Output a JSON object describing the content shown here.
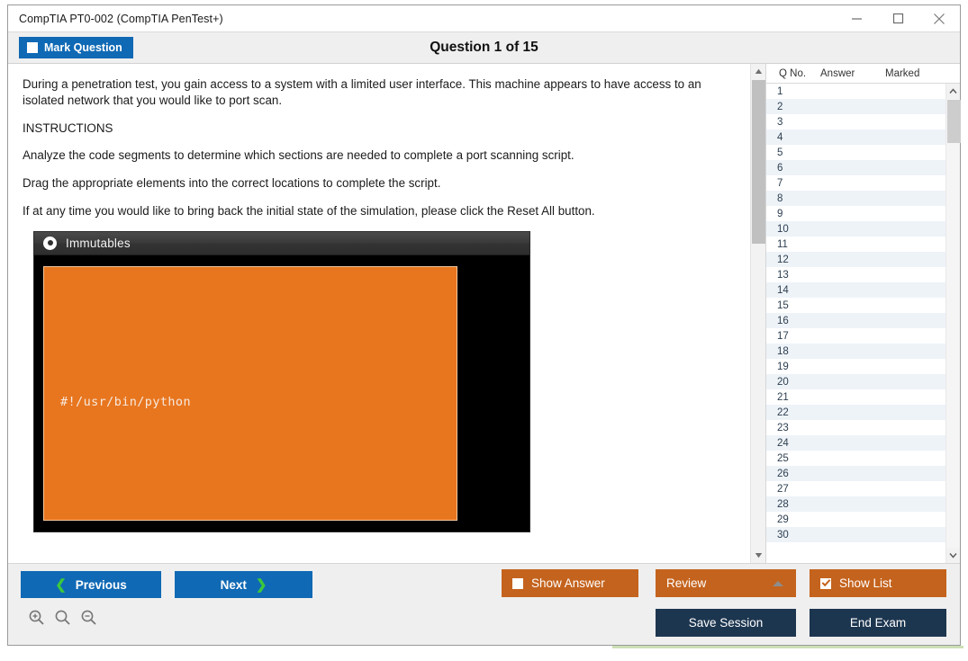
{
  "window": {
    "title": "CompTIA PT0-002 (CompTIA PenTest+)",
    "controls": {
      "minimize": "minimize-icon",
      "maximize": "maximize-icon",
      "close": "close-icon"
    }
  },
  "header": {
    "mark_question_label": "Mark Question",
    "mark_question_checked": false,
    "question_title": "Question 1 of 15"
  },
  "content": {
    "paragraphs": [
      "During a penetration test, you gain access to a system with a limited user interface. This machine appears to have access to an isolated network that you would like to port scan.",
      "INSTRUCTIONS",
      "Analyze the code segments to determine which sections are needed to complete a port scanning script.",
      "Drag the appropriate elements into the correct locations to complete the script.",
      "If at any time you would like to bring back the initial state of the simulation, please click the Reset All button."
    ]
  },
  "simulation": {
    "panel_title": "Immutables",
    "code_text": "#!/usr/bin/python",
    "code_bg_color": "#e8761f",
    "panel_bg_color": "#000000"
  },
  "question_list": {
    "columns": [
      "Q No.",
      "Answer",
      "Marked"
    ],
    "rows": [
      {
        "qno": "1",
        "answer": "",
        "marked": ""
      },
      {
        "qno": "2",
        "answer": "",
        "marked": ""
      },
      {
        "qno": "3",
        "answer": "",
        "marked": ""
      },
      {
        "qno": "4",
        "answer": "",
        "marked": ""
      },
      {
        "qno": "5",
        "answer": "",
        "marked": ""
      },
      {
        "qno": "6",
        "answer": "",
        "marked": ""
      },
      {
        "qno": "7",
        "answer": "",
        "marked": ""
      },
      {
        "qno": "8",
        "answer": "",
        "marked": ""
      },
      {
        "qno": "9",
        "answer": "",
        "marked": ""
      },
      {
        "qno": "10",
        "answer": "",
        "marked": ""
      },
      {
        "qno": "11",
        "answer": "",
        "marked": ""
      },
      {
        "qno": "12",
        "answer": "",
        "marked": ""
      },
      {
        "qno": "13",
        "answer": "",
        "marked": ""
      },
      {
        "qno": "14",
        "answer": "",
        "marked": ""
      },
      {
        "qno": "15",
        "answer": "",
        "marked": ""
      },
      {
        "qno": "16",
        "answer": "",
        "marked": ""
      },
      {
        "qno": "17",
        "answer": "",
        "marked": ""
      },
      {
        "qno": "18",
        "answer": "",
        "marked": ""
      },
      {
        "qno": "19",
        "answer": "",
        "marked": ""
      },
      {
        "qno": "20",
        "answer": "",
        "marked": ""
      },
      {
        "qno": "21",
        "answer": "",
        "marked": ""
      },
      {
        "qno": "22",
        "answer": "",
        "marked": ""
      },
      {
        "qno": "23",
        "answer": "",
        "marked": ""
      },
      {
        "qno": "24",
        "answer": "",
        "marked": ""
      },
      {
        "qno": "25",
        "answer": "",
        "marked": ""
      },
      {
        "qno": "26",
        "answer": "",
        "marked": ""
      },
      {
        "qno": "27",
        "answer": "",
        "marked": ""
      },
      {
        "qno": "28",
        "answer": "",
        "marked": ""
      },
      {
        "qno": "29",
        "answer": "",
        "marked": ""
      },
      {
        "qno": "30",
        "answer": "",
        "marked": ""
      }
    ]
  },
  "footer": {
    "previous_label": "Previous",
    "next_label": "Next",
    "show_answer_label": "Show Answer",
    "show_answer_checked": false,
    "review_label": "Review",
    "show_list_label": "Show List",
    "show_list_checked": true,
    "save_session_label": "Save Session",
    "end_exam_label": "End Exam",
    "zoom_in_icon": "zoom-in-icon",
    "zoom_reset_icon": "zoom-reset-icon",
    "zoom_out_icon": "zoom-out-icon"
  },
  "colors": {
    "accent_blue": "#1069b4",
    "accent_orange": "#c4631d",
    "navy": "#1d3650",
    "chevron_green": "#3cc93c"
  }
}
